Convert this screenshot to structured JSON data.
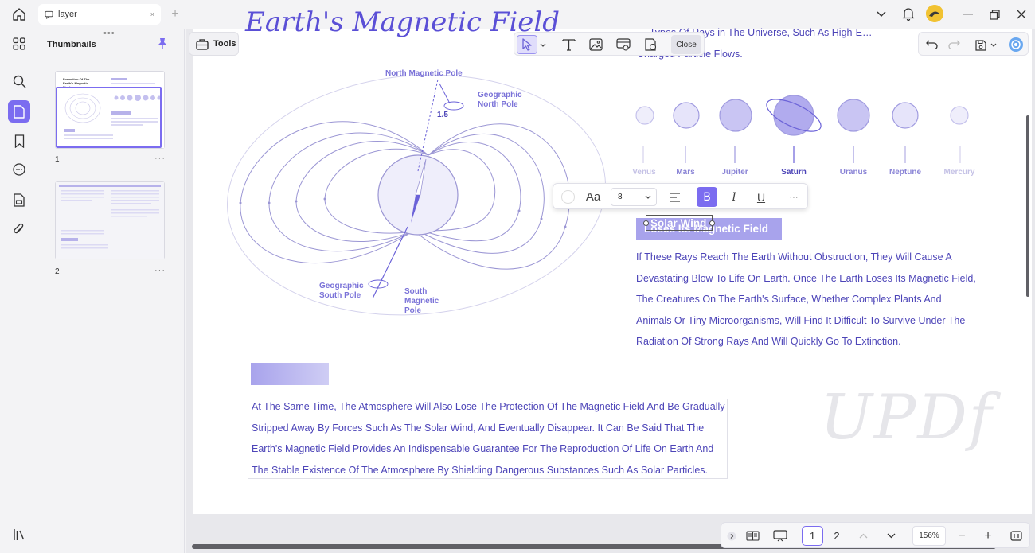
{
  "tab": {
    "title": "layer",
    "close": "×",
    "new_tab": "+"
  },
  "thumbnails": {
    "title": "Thumbnails",
    "pages": [
      {
        "num": "1",
        "menu": "···"
      },
      {
        "num": "2",
        "menu": "···"
      }
    ],
    "mini_title": "Formation Of The Earth's Magnetic Field"
  },
  "toolbar": {
    "tools_label": "Tools",
    "close_label": "Close"
  },
  "document": {
    "title": "Earth's Magnetic Field",
    "top_text_line1": "… Types Of Rays in The Universe, Such As High-E…",
    "top_text_line2": "Charged Particle Flows.",
    "diagram_labels": {
      "north_magnetic": "North Magnetic Pole",
      "geographic_north": "Geographic North Pole",
      "angle": "1.5",
      "geographic_south": "Geographic South Pole",
      "south_magnetic": "South Magnetic Pole"
    },
    "planets": [
      "Venus",
      "Mars",
      "Jupiter",
      "Saturn",
      "Uranus",
      "Neptune",
      "Mercury"
    ],
    "solar_wind_label": "Solar Wind",
    "heading": "Loses Its Magnetic Field",
    "para1": "If These Rays Reach The Earth Without Obstruction, They Will Cause A Devastating Blow To Life On Earth. Once The Earth Loses Its Magnetic Field, The Creatures On The Earth's Surface, Whether Complex Plants And Animals Or Tiny Microorganisms, Will Find It Difficult To Survive Under The Radiation Of Strong Rays And Will Quickly Go To Extinction.",
    "para2": "At The Same Time, The Atmosphere Will Also Lose The Protection Of The Magnetic Field And Be Gradually Stripped Away By Forces Such As The Solar Wind, And Eventually Disappear. It Can Be Said That The Earth's Magnetic Field Provides An Indispensable Guarantee For The Reproduction Of Life On Earth And The Stable Existence Of The Atmosphere By Shielding Dangerous Substances Such As Solar Particles.",
    "watermark": "UPDf"
  },
  "format_toolbar": {
    "font_icon": "Aa",
    "font_size": "8",
    "bold": "B",
    "italic": "I",
    "underline": "U",
    "more": "···"
  },
  "bottom": {
    "page1": "1",
    "page2": "2",
    "zoom": "156%",
    "zoom_out": "−",
    "zoom_in": "+"
  },
  "colors": {
    "accent": "#7b6cf0",
    "text_purple": "#4d45b8"
  }
}
